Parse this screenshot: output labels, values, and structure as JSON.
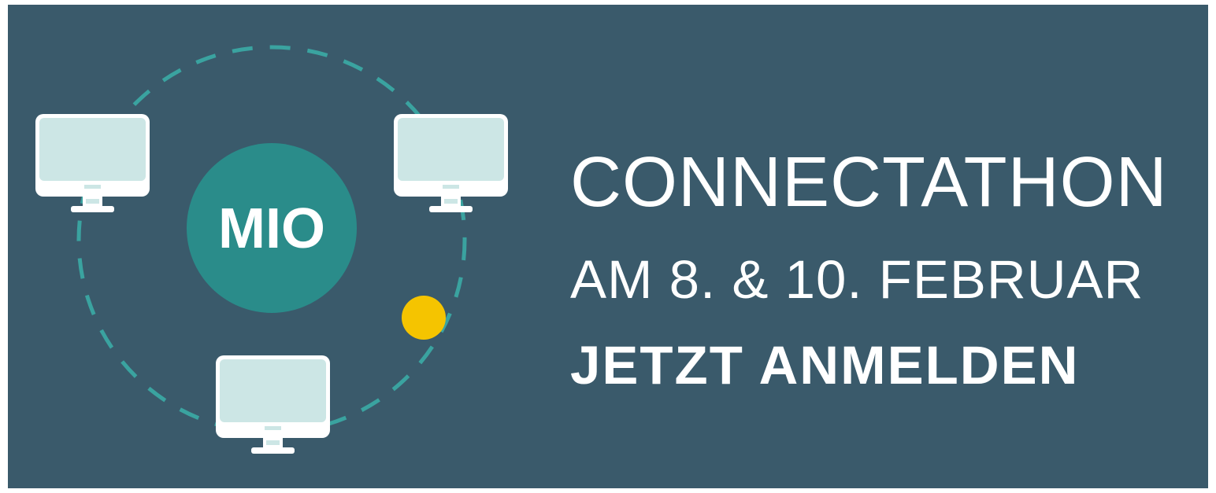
{
  "logo": {
    "text": "MIO"
  },
  "headline": {
    "title": "CONNECTATHON",
    "dates": "AM 8. & 10. FEBRUAR",
    "cta": "JETZT ANMELDEN"
  },
  "colors": {
    "panel_background": "#3a5a6b",
    "teal_circle": "#2a8c8a",
    "monitor_screen": "#cce6e5",
    "monitor_outline": "#ffffff",
    "dashed_ring": "#3aa3a0",
    "accent_dot": "#f5c400"
  },
  "icons": [
    "monitor-icon-top-left",
    "monitor-icon-top-right",
    "monitor-icon-bottom",
    "accent-dot"
  ]
}
